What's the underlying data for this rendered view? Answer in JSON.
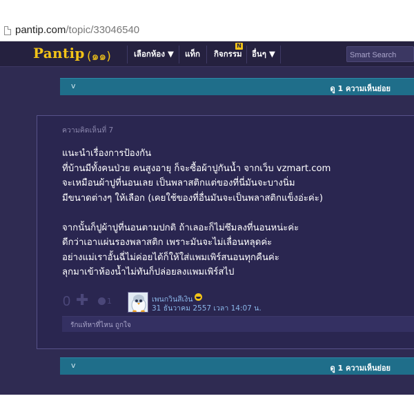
{
  "browser": {
    "url_domain": "pantip.com",
    "url_path": "/topic/33046540"
  },
  "navbar": {
    "logo_text": "Pantip",
    "logo_mark": "(๑๑)",
    "items": [
      {
        "label": "เลือกห้อง ▼"
      },
      {
        "label": "แท็ก"
      },
      {
        "label": "กิจกรรม"
      },
      {
        "label": "อื่นๆ ▼"
      }
    ],
    "activity_badge": "N",
    "search_placeholder": "Smart Search"
  },
  "reply_bar_top": {
    "chevron": "v",
    "label": "ดู 1 ความเห็นย่อย"
  },
  "comment": {
    "number_label": "ความคิดเห็นที่ 7",
    "paragraphs": [
      [
        "แนะนำเรื่องการป้องกัน",
        "ที่บ้านมีทั้งคนป่วย คนสูงอายุ ก็จะซื้อผ้าปูกันน้ำ จากเว็บ  vzmart.com",
        "จะเหมือนผ้าปูที่นอนเลย เป็นพลาสติกแต่ของที่นี่มันจะบางนิ่ม",
        "มีขนาดต่างๆ ให้เลือก (เคยใช้ของที่อื่นมันจะเป็นพลาสติกแข็งอ่ะค่ะ)"
      ],
      [
        "จากนั้นก็ปูผ้าปูที่นอนตามปกติ ถ้าเลอะก็ไม่ซึมลงที่นอนหน่ะค่ะ",
        "ดีกว่าเอาแผ่นรองพลาสติก เพราะมันจะไม่เลื่อนหลุดค่ะ",
        "อย่างแม่เราอั้นฉี่ไม่ค่อยได้ก็ให้ใส่แพมเพิร์สนอนทุกคืนค่ะ",
        "ลุกมาเข้าห้องน้ำไม่ทันก็ปล่อยลงแพมเพิร์สไป"
      ]
    ],
    "vote_count": "0",
    "vote_plus": "✚",
    "emotion_count": "1",
    "username": "เพนกวินสีเงิน",
    "timestamp": "31 ธันวาคม 2557 เวลา 14:07 น.",
    "signature": "รักแท้หาที่ไหน ถูกใจ"
  },
  "reply_bar_bottom": {
    "chevron": "v",
    "label": "ดู 1 ความเห็นย่อย"
  },
  "colors": {
    "brand_yellow": "#f2c318",
    "page_bg": "#2f2b52",
    "reply_bar": "#1f6e8a",
    "link_blue": "#8ab6e8"
  }
}
